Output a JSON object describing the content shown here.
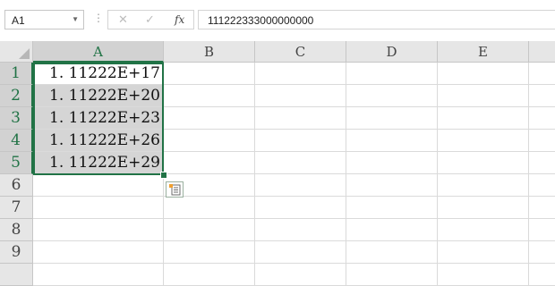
{
  "formula_bar": {
    "name_box": "A1",
    "formula": "111222333000000000",
    "separator": "⋮",
    "cancel_icon": "cancel-icon",
    "enter_icon": "enter-icon",
    "function_label": "fx"
  },
  "columns": [
    "A",
    "B",
    "C",
    "D",
    "E"
  ],
  "rows": [
    "1",
    "2",
    "3",
    "4",
    "5",
    "6",
    "7",
    "8",
    "9"
  ],
  "cells": {
    "A1": "1. 11222E+17",
    "A2": "1. 11222E+20",
    "A3": "1. 11222E+23",
    "A4": "1. 11222E+26",
    "A5": "1. 11222E+29"
  },
  "selection": {
    "range": "A1:A5",
    "active": "A1"
  },
  "colors": {
    "accent": "#217346",
    "header_bg": "#e6e6e6",
    "selected_bg": "#d5d5d5"
  },
  "quick_analysis_icon": "quick-analysis-icon"
}
